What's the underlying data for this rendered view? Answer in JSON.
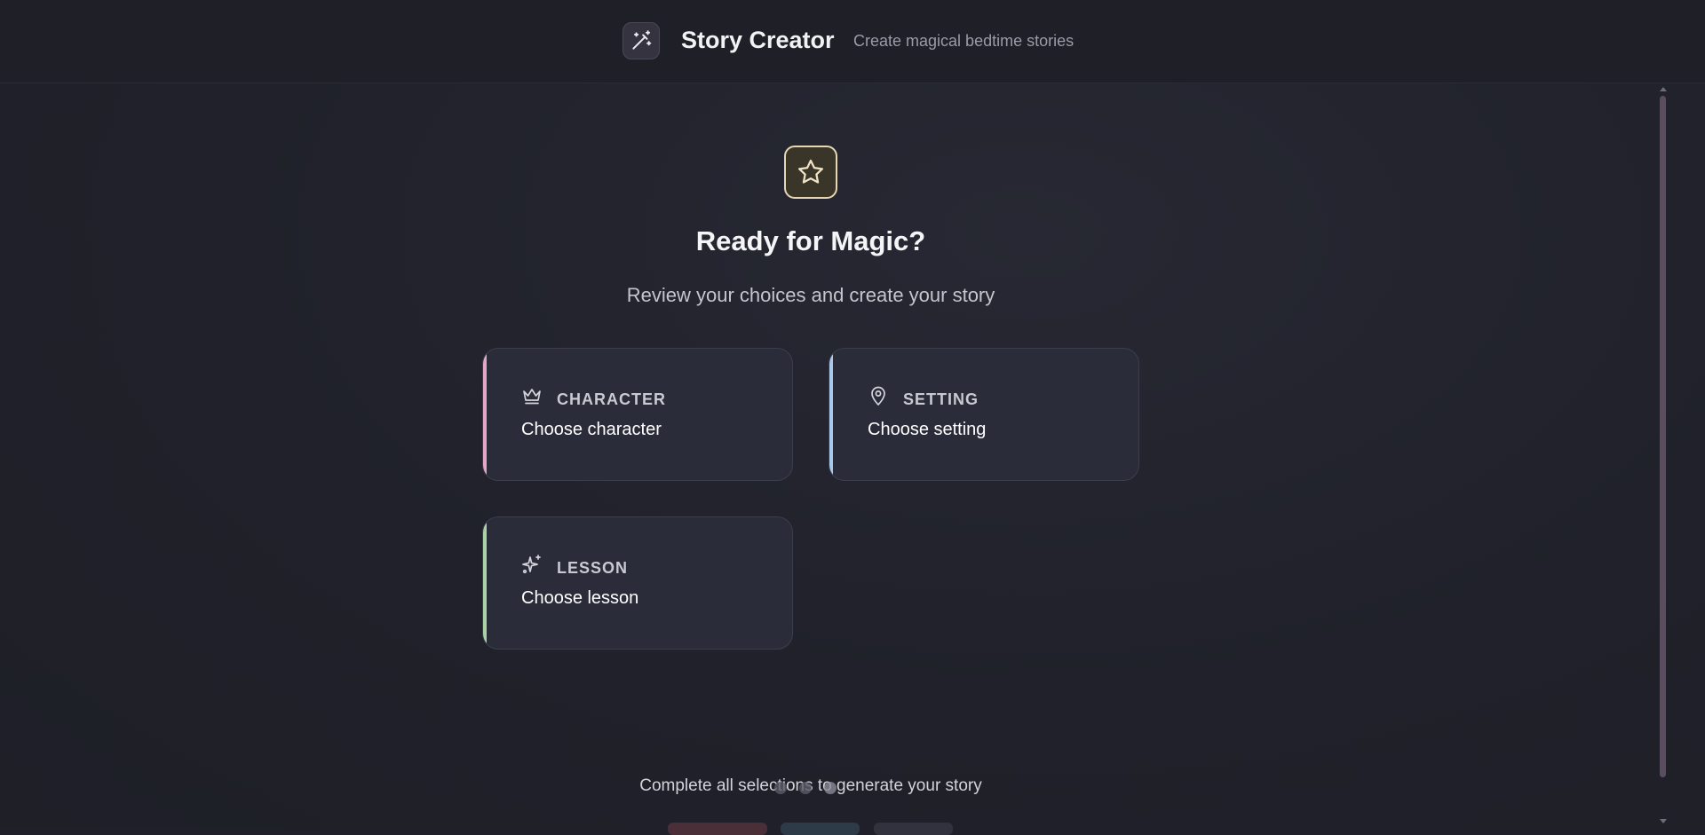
{
  "header": {
    "title": "Story Creator",
    "subtitle": "Create magical bedtime stories",
    "icon": "magic-wand-icon"
  },
  "hero": {
    "icon": "star-icon",
    "title": "Ready for Magic?",
    "subtitle": "Review your choices and create your story"
  },
  "cards": [
    {
      "icon": "crown-icon",
      "label": "CHARACTER",
      "value": "Choose character",
      "accent": "#e3a6c4"
    },
    {
      "icon": "map-pin-icon",
      "label": "SETTING",
      "value": "Choose setting",
      "accent": "#a8c9ec"
    },
    {
      "icon": "sparkles-icon",
      "label": "LESSON",
      "value": "Choose lesson",
      "accent": "#a9d3a7"
    }
  ],
  "footer": {
    "hint": "Complete all selections to generate your story",
    "progress_steps": 3
  },
  "colors": {
    "background": "#1f2029",
    "card": "#2b2c39",
    "hero_icon_border": "#e7d6b3"
  }
}
